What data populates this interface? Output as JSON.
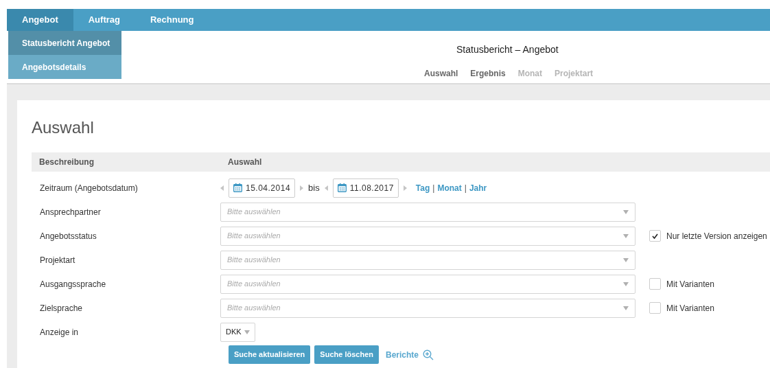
{
  "nav": {
    "tabs": [
      {
        "label": "Angebot",
        "selected": true
      },
      {
        "label": "Auftrag",
        "selected": false
      },
      {
        "label": "Rechnung",
        "selected": false
      }
    ],
    "submenu": [
      {
        "label": "Statusbericht Angebot",
        "selected": true
      },
      {
        "label": "Angebotsdetails",
        "selected": false
      }
    ]
  },
  "header": {
    "title": "Statusbericht – Angebot",
    "subtabs": [
      {
        "label": "Auswahl",
        "disabled": false
      },
      {
        "label": "Ergebnis",
        "disabled": false
      },
      {
        "label": "Monat",
        "disabled": true
      },
      {
        "label": "Projektart",
        "disabled": true
      }
    ]
  },
  "panel": {
    "heading": "Auswahl",
    "columns": [
      "Beschreibung",
      "Auswahl"
    ],
    "rows": [
      {
        "kind": "daterange",
        "label": "Zeitraum (Angebotsdatum)",
        "from": "15.04.2014",
        "separator": "bis",
        "to": "11.08.2017",
        "links": [
          {
            "kind": "link",
            "text": "Tag"
          },
          {
            "kind": "divider",
            "text": "|"
          },
          {
            "kind": "link",
            "text": "Monat"
          },
          {
            "kind": "divider",
            "text": "|"
          },
          {
            "kind": "link",
            "text": "Jahr"
          }
        ]
      },
      {
        "kind": "select",
        "label": "Ansprechpartner",
        "placeholder": "Bitte auswählen"
      },
      {
        "kind": "select",
        "label": "Angebotsstatus",
        "placeholder": "Bitte auswählen",
        "option": {
          "label": "Nur letzte Version anzeigen",
          "checked": true
        }
      },
      {
        "kind": "select",
        "label": "Projektart",
        "placeholder": "Bitte auswählen"
      },
      {
        "kind": "select",
        "label": "Ausgangssprache",
        "placeholder": "Bitte auswählen",
        "option": {
          "label": "Mit Varianten",
          "checked": false
        }
      },
      {
        "kind": "select",
        "label": "Zielsprache",
        "placeholder": "Bitte auswählen",
        "option": {
          "label": "Mit Varianten",
          "checked": false
        }
      },
      {
        "kind": "currency",
        "label": "Anzeige in",
        "value": "DKK"
      }
    ],
    "buttons": [
      "Suche aktualisieren",
      "Suche löschen"
    ],
    "reports_link": "Berichte"
  }
}
